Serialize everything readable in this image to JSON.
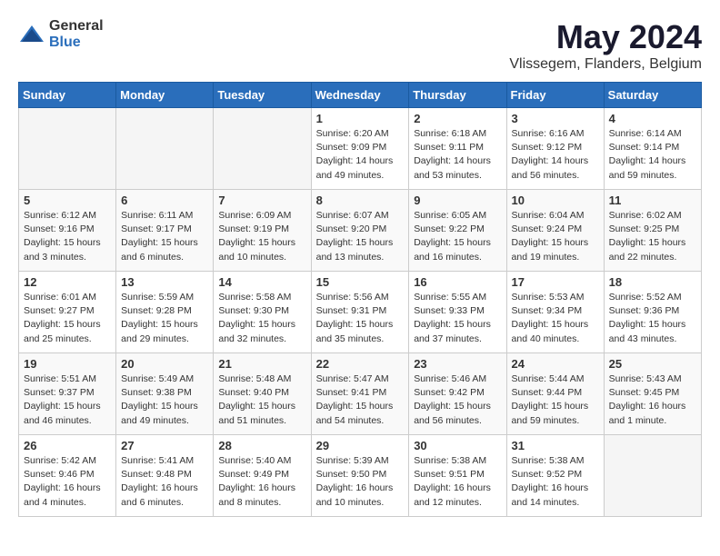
{
  "logo": {
    "general": "General",
    "blue": "Blue"
  },
  "title": "May 2024",
  "location": "Vlissegem, Flanders, Belgium",
  "weekdays": [
    "Sunday",
    "Monday",
    "Tuesday",
    "Wednesday",
    "Thursday",
    "Friday",
    "Saturday"
  ],
  "weeks": [
    [
      null,
      null,
      null,
      {
        "day": "1",
        "sunrise": "Sunrise: 6:20 AM",
        "sunset": "Sunset: 9:09 PM",
        "daylight": "Daylight: 14 hours and 49 minutes."
      },
      {
        "day": "2",
        "sunrise": "Sunrise: 6:18 AM",
        "sunset": "Sunset: 9:11 PM",
        "daylight": "Daylight: 14 hours and 53 minutes."
      },
      {
        "day": "3",
        "sunrise": "Sunrise: 6:16 AM",
        "sunset": "Sunset: 9:12 PM",
        "daylight": "Daylight: 14 hours and 56 minutes."
      },
      {
        "day": "4",
        "sunrise": "Sunrise: 6:14 AM",
        "sunset": "Sunset: 9:14 PM",
        "daylight": "Daylight: 14 hours and 59 minutes."
      }
    ],
    [
      {
        "day": "5",
        "sunrise": "Sunrise: 6:12 AM",
        "sunset": "Sunset: 9:16 PM",
        "daylight": "Daylight: 15 hours and 3 minutes."
      },
      {
        "day": "6",
        "sunrise": "Sunrise: 6:11 AM",
        "sunset": "Sunset: 9:17 PM",
        "daylight": "Daylight: 15 hours and 6 minutes."
      },
      {
        "day": "7",
        "sunrise": "Sunrise: 6:09 AM",
        "sunset": "Sunset: 9:19 PM",
        "daylight": "Daylight: 15 hours and 10 minutes."
      },
      {
        "day": "8",
        "sunrise": "Sunrise: 6:07 AM",
        "sunset": "Sunset: 9:20 PM",
        "daylight": "Daylight: 15 hours and 13 minutes."
      },
      {
        "day": "9",
        "sunrise": "Sunrise: 6:05 AM",
        "sunset": "Sunset: 9:22 PM",
        "daylight": "Daylight: 15 hours and 16 minutes."
      },
      {
        "day": "10",
        "sunrise": "Sunrise: 6:04 AM",
        "sunset": "Sunset: 9:24 PM",
        "daylight": "Daylight: 15 hours and 19 minutes."
      },
      {
        "day": "11",
        "sunrise": "Sunrise: 6:02 AM",
        "sunset": "Sunset: 9:25 PM",
        "daylight": "Daylight: 15 hours and 22 minutes."
      }
    ],
    [
      {
        "day": "12",
        "sunrise": "Sunrise: 6:01 AM",
        "sunset": "Sunset: 9:27 PM",
        "daylight": "Daylight: 15 hours and 25 minutes."
      },
      {
        "day": "13",
        "sunrise": "Sunrise: 5:59 AM",
        "sunset": "Sunset: 9:28 PM",
        "daylight": "Daylight: 15 hours and 29 minutes."
      },
      {
        "day": "14",
        "sunrise": "Sunrise: 5:58 AM",
        "sunset": "Sunset: 9:30 PM",
        "daylight": "Daylight: 15 hours and 32 minutes."
      },
      {
        "day": "15",
        "sunrise": "Sunrise: 5:56 AM",
        "sunset": "Sunset: 9:31 PM",
        "daylight": "Daylight: 15 hours and 35 minutes."
      },
      {
        "day": "16",
        "sunrise": "Sunrise: 5:55 AM",
        "sunset": "Sunset: 9:33 PM",
        "daylight": "Daylight: 15 hours and 37 minutes."
      },
      {
        "day": "17",
        "sunrise": "Sunrise: 5:53 AM",
        "sunset": "Sunset: 9:34 PM",
        "daylight": "Daylight: 15 hours and 40 minutes."
      },
      {
        "day": "18",
        "sunrise": "Sunrise: 5:52 AM",
        "sunset": "Sunset: 9:36 PM",
        "daylight": "Daylight: 15 hours and 43 minutes."
      }
    ],
    [
      {
        "day": "19",
        "sunrise": "Sunrise: 5:51 AM",
        "sunset": "Sunset: 9:37 PM",
        "daylight": "Daylight: 15 hours and 46 minutes."
      },
      {
        "day": "20",
        "sunrise": "Sunrise: 5:49 AM",
        "sunset": "Sunset: 9:38 PM",
        "daylight": "Daylight: 15 hours and 49 minutes."
      },
      {
        "day": "21",
        "sunrise": "Sunrise: 5:48 AM",
        "sunset": "Sunset: 9:40 PM",
        "daylight": "Daylight: 15 hours and 51 minutes."
      },
      {
        "day": "22",
        "sunrise": "Sunrise: 5:47 AM",
        "sunset": "Sunset: 9:41 PM",
        "daylight": "Daylight: 15 hours and 54 minutes."
      },
      {
        "day": "23",
        "sunrise": "Sunrise: 5:46 AM",
        "sunset": "Sunset: 9:42 PM",
        "daylight": "Daylight: 15 hours and 56 minutes."
      },
      {
        "day": "24",
        "sunrise": "Sunrise: 5:44 AM",
        "sunset": "Sunset: 9:44 PM",
        "daylight": "Daylight: 15 hours and 59 minutes."
      },
      {
        "day": "25",
        "sunrise": "Sunrise: 5:43 AM",
        "sunset": "Sunset: 9:45 PM",
        "daylight": "Daylight: 16 hours and 1 minute."
      }
    ],
    [
      {
        "day": "26",
        "sunrise": "Sunrise: 5:42 AM",
        "sunset": "Sunset: 9:46 PM",
        "daylight": "Daylight: 16 hours and 4 minutes."
      },
      {
        "day": "27",
        "sunrise": "Sunrise: 5:41 AM",
        "sunset": "Sunset: 9:48 PM",
        "daylight": "Daylight: 16 hours and 6 minutes."
      },
      {
        "day": "28",
        "sunrise": "Sunrise: 5:40 AM",
        "sunset": "Sunset: 9:49 PM",
        "daylight": "Daylight: 16 hours and 8 minutes."
      },
      {
        "day": "29",
        "sunrise": "Sunrise: 5:39 AM",
        "sunset": "Sunset: 9:50 PM",
        "daylight": "Daylight: 16 hours and 10 minutes."
      },
      {
        "day": "30",
        "sunrise": "Sunrise: 5:38 AM",
        "sunset": "Sunset: 9:51 PM",
        "daylight": "Daylight: 16 hours and 12 minutes."
      },
      {
        "day": "31",
        "sunrise": "Sunrise: 5:38 AM",
        "sunset": "Sunset: 9:52 PM",
        "daylight": "Daylight: 16 hours and 14 minutes."
      },
      null
    ]
  ]
}
